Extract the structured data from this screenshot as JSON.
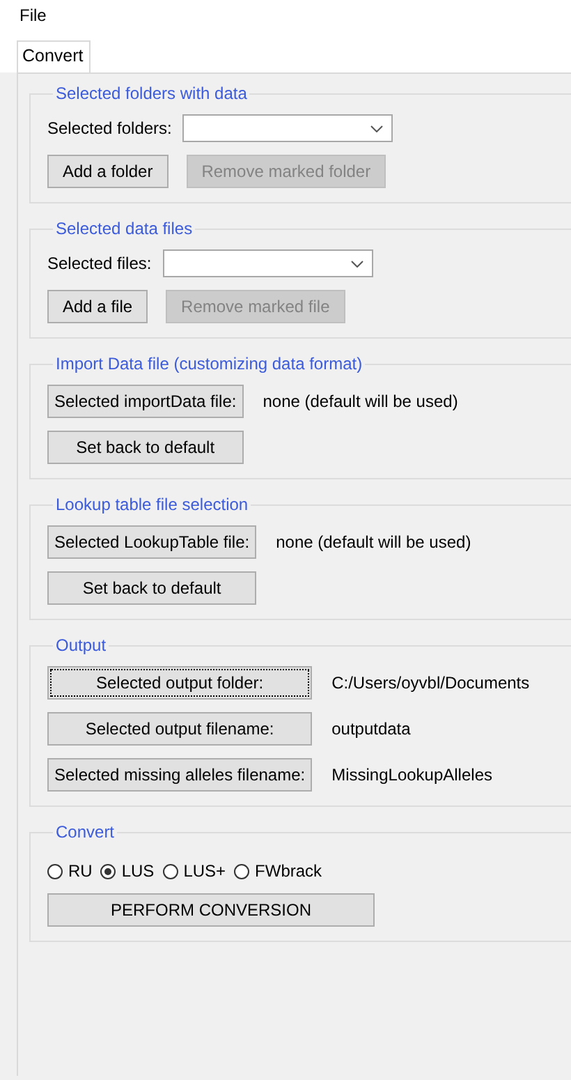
{
  "menu": [
    {
      "label": "File"
    }
  ],
  "tabs": [
    {
      "label": "Convert",
      "selected": true
    }
  ],
  "groups": [
    {
      "title": "Selected folders with data",
      "rows": [
        {
          "kind": "combo",
          "label": "Selected folders:"
        },
        {
          "kind": "buttons",
          "buttons": [
            {
              "label": "Add a folder",
              "disabled": false
            },
            {
              "label": "Remove marked folder",
              "disabled": true
            }
          ]
        }
      ]
    },
    {
      "title": "Selected data files",
      "rows": [
        {
          "kind": "combo",
          "label": "Selected files:"
        },
        {
          "kind": "buttons",
          "buttons": [
            {
              "label": "Add a file",
              "disabled": false
            },
            {
              "label": "Remove marked file",
              "disabled": true
            }
          ]
        }
      ]
    },
    {
      "title": "Import Data file (customizing data format)",
      "rows": [
        {
          "kind": "button_value",
          "button": "Selected importData file:",
          "value": "none (default will be used)",
          "focused": false
        },
        {
          "kind": "button",
          "button": "Set back to default"
        }
      ]
    },
    {
      "title": "Lookup table file selection",
      "rows": [
        {
          "kind": "button_value",
          "button": "Selected LookupTable file:",
          "value": "none (default will be used)",
          "focused": false
        },
        {
          "kind": "button",
          "button": "Set back to default"
        }
      ]
    },
    {
      "title": "Output",
      "rows": [
        {
          "kind": "button_value",
          "button": "Selected output folder:",
          "value": "C:/Users/oyvbl/Documents",
          "focused": true
        },
        {
          "kind": "button_value",
          "button": "Selected output filename:",
          "value": "outputdata",
          "focused": false
        },
        {
          "kind": "button_value",
          "button": "Selected missing alleles filename:",
          "value": "MissingLookupAlleles",
          "focused": false
        }
      ]
    },
    {
      "title": "Convert",
      "rows": [
        {
          "kind": "radios",
          "options": [
            {
              "label": "RU",
              "selected": false
            },
            {
              "label": "LUS",
              "selected": true
            },
            {
              "label": "LUS+",
              "selected": false
            },
            {
              "label": "FWbrack",
              "selected": false
            }
          ]
        },
        {
          "kind": "wide_button",
          "button": "PERFORM CONVERSION"
        }
      ]
    }
  ]
}
